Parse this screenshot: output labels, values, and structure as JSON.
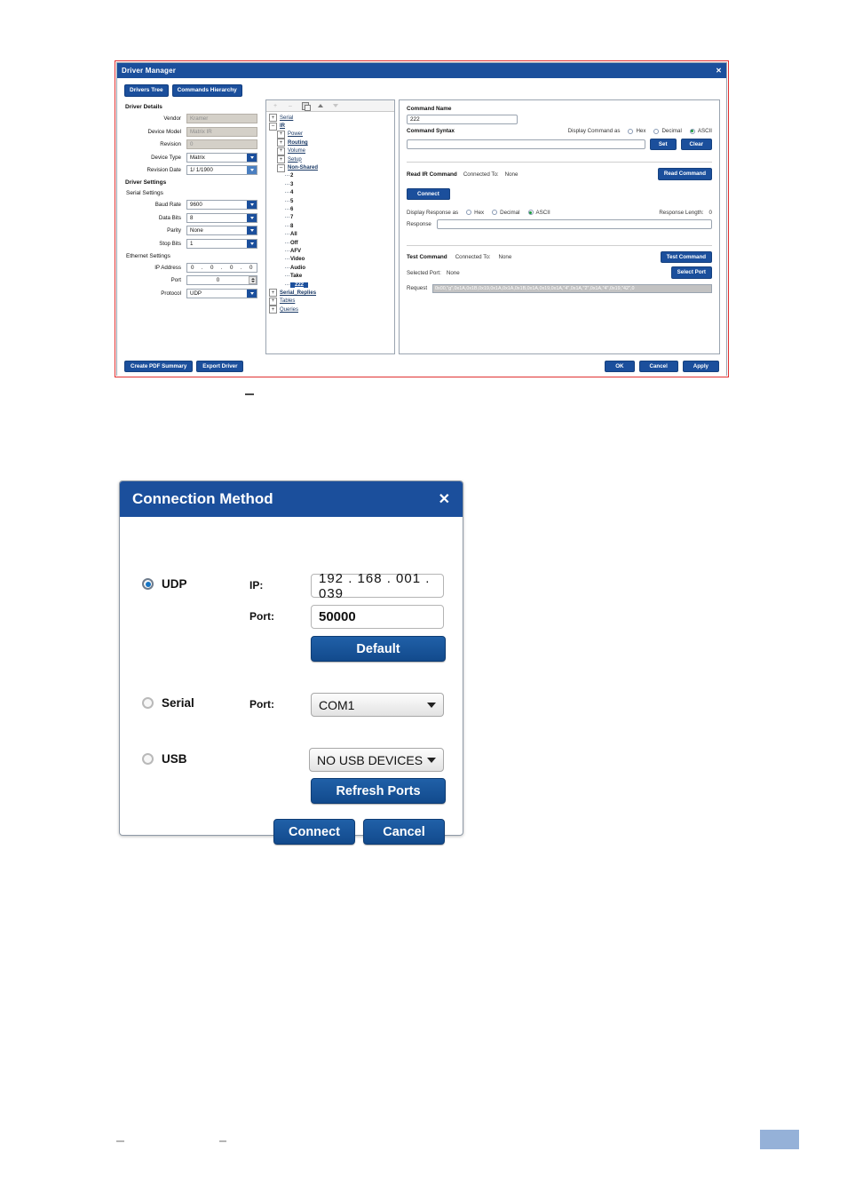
{
  "driver_manager": {
    "title": "Driver Manager",
    "close_icon": "close-icon",
    "tabs": [
      {
        "label": "Drivers Tree"
      },
      {
        "label": "Commands Hierarchy"
      }
    ],
    "driver_details": {
      "heading": "Driver Details",
      "fields": [
        {
          "label": "Vendor",
          "value": "Kramer",
          "type": "text-disabled"
        },
        {
          "label": "Device Model",
          "value": "Matrix IR",
          "type": "text-disabled"
        },
        {
          "label": "Revision",
          "value": "0",
          "type": "text-disabled"
        },
        {
          "label": "Device Type",
          "value": "Matrix",
          "type": "combo"
        },
        {
          "label": "Revision Date",
          "value": "1/ 1/1900",
          "type": "date"
        }
      ]
    },
    "driver_settings": {
      "heading": "Driver Settings",
      "serial_heading": "Serial Settings",
      "serial": [
        {
          "label": "Baud Rate",
          "value": "9600"
        },
        {
          "label": "Data Bits",
          "value": "8"
        },
        {
          "label": "Parity",
          "value": "None"
        },
        {
          "label": "Stop Bits",
          "value": "1"
        }
      ],
      "ethernet_heading": "Ethernet Settings",
      "ip_label": "IP Address",
      "ip_octets": [
        "0",
        "0",
        "0",
        "0"
      ],
      "port_label": "Port",
      "port_value": "0",
      "protocol_label": "Protocol",
      "protocol_value": "UDP"
    },
    "tree_toolbar": [
      {
        "icon": "add-icon",
        "glyph": "+"
      },
      {
        "icon": "remove-icon",
        "glyph": "–"
      },
      {
        "icon": "copy-icon",
        "glyph": ""
      },
      {
        "icon": "move-up-icon",
        "glyph": ""
      },
      {
        "icon": "move-down-icon",
        "glyph": ""
      }
    ],
    "tree": [
      {
        "label": "Serial",
        "depth": 0,
        "expander": "+",
        "bold": false,
        "leaf": false,
        "selected": false
      },
      {
        "label": "IR",
        "depth": 0,
        "expander": "–",
        "bold": true,
        "leaf": false,
        "selected": false
      },
      {
        "label": "Power",
        "depth": 1,
        "expander": "+",
        "bold": false,
        "leaf": false,
        "selected": false
      },
      {
        "label": "Routing",
        "depth": 1,
        "expander": "+",
        "bold": true,
        "leaf": false,
        "selected": false
      },
      {
        "label": "Volume",
        "depth": 1,
        "expander": "+",
        "bold": false,
        "leaf": false,
        "selected": false
      },
      {
        "label": "Setup",
        "depth": 1,
        "expander": "+",
        "bold": false,
        "leaf": false,
        "selected": false
      },
      {
        "label": "Non-Shared",
        "depth": 1,
        "expander": "–",
        "bold": true,
        "leaf": false,
        "selected": false
      },
      {
        "label": "2",
        "depth": 2,
        "expander": "",
        "bold": false,
        "leaf": true,
        "selected": false
      },
      {
        "label": "3",
        "depth": 2,
        "expander": "",
        "bold": false,
        "leaf": true,
        "selected": false
      },
      {
        "label": "4",
        "depth": 2,
        "expander": "",
        "bold": false,
        "leaf": true,
        "selected": false
      },
      {
        "label": "5",
        "depth": 2,
        "expander": "",
        "bold": false,
        "leaf": true,
        "selected": false
      },
      {
        "label": "6",
        "depth": 2,
        "expander": "",
        "bold": false,
        "leaf": true,
        "selected": false
      },
      {
        "label": "7",
        "depth": 2,
        "expander": "",
        "bold": false,
        "leaf": true,
        "selected": false
      },
      {
        "label": "8",
        "depth": 2,
        "expander": "",
        "bold": false,
        "leaf": true,
        "selected": false
      },
      {
        "label": "All",
        "depth": 2,
        "expander": "",
        "bold": false,
        "leaf": true,
        "selected": false
      },
      {
        "label": "Off",
        "depth": 2,
        "expander": "",
        "bold": false,
        "leaf": true,
        "selected": false
      },
      {
        "label": "AFV",
        "depth": 2,
        "expander": "",
        "bold": false,
        "leaf": true,
        "selected": false
      },
      {
        "label": "Video",
        "depth": 2,
        "expander": "",
        "bold": false,
        "leaf": true,
        "selected": false
      },
      {
        "label": "Audio",
        "depth": 2,
        "expander": "",
        "bold": false,
        "leaf": true,
        "selected": false
      },
      {
        "label": "Take",
        "depth": 2,
        "expander": "",
        "bold": false,
        "leaf": true,
        "selected": false
      },
      {
        "label": "222",
        "depth": 2,
        "expander": "",
        "bold": false,
        "leaf": true,
        "selected": true
      },
      {
        "label": "Serial_Replies",
        "depth": 0,
        "expander": "+",
        "bold": true,
        "leaf": false,
        "selected": false
      },
      {
        "label": "Tables",
        "depth": 0,
        "expander": "+",
        "bold": false,
        "leaf": false,
        "selected": false
      },
      {
        "label": "Queries",
        "depth": 0,
        "expander": "+",
        "bold": false,
        "leaf": false,
        "selected": false
      }
    ],
    "command": {
      "name_label": "Command Name",
      "name_value": "222",
      "syntax_label": "Command Syntax",
      "syntax_value": "",
      "display_as_label": "Display Command as",
      "display_options": [
        {
          "label": "Hex",
          "selected": false
        },
        {
          "label": "Decimal",
          "selected": false
        },
        {
          "label": "ASCII",
          "selected": true
        }
      ],
      "set_label": "Set",
      "clear_label": "Clear"
    },
    "read_ir": {
      "heading": "Read IR Command",
      "connected_to_label": "Connected To:",
      "connected_to_value": "None",
      "read_command_label": "Read Command",
      "connect_label": "Connect",
      "display_response_label": "Display Response as",
      "response_options": [
        {
          "label": "Hex",
          "selected": false
        },
        {
          "label": "Decimal",
          "selected": false
        },
        {
          "label": "ASCII",
          "selected": true
        }
      ],
      "response_length_label": "Response Length:",
      "response_length_value": "0",
      "response_label": "Response",
      "response_value": ""
    },
    "test": {
      "heading": "Test Command",
      "connected_to_label": "Connected To:",
      "connected_to_value": "None",
      "test_command_label": "Test Command",
      "selected_port_label": "Selected Port:",
      "selected_port_value": "None",
      "select_port_label": "Select Port",
      "request_label": "Request",
      "request_value": "0x00,\"g\",0x1A,0x1B,0x19,0x1A,0x1A,0x1B,0x1A,0x19,0x1A,\"4\",0x1A,\"2\",0x1A,\"4\",0x19,\"42\",0"
    },
    "footer": {
      "create_pdf_label": "Create PDF Summary",
      "export_driver_label": "Export Driver",
      "ok_label": "OK",
      "cancel_label": "Cancel",
      "apply_label": "Apply"
    }
  },
  "connection_method": {
    "title": "Connection Method",
    "close_icon": "close-icon",
    "udp": {
      "label": "UDP",
      "selected": true,
      "ip_label": "IP:",
      "ip_value": "192 . 168 . 001 . 039",
      "port_label": "Port:",
      "port_value": "50000",
      "default_label": "Default"
    },
    "serial": {
      "label": "Serial",
      "selected": false,
      "port_label": "Port:",
      "port_value": "COM1"
    },
    "usb": {
      "label": "USB",
      "selected": false,
      "device_value": "NO USB DEVICES",
      "refresh_label": "Refresh Ports"
    },
    "connect_label": "Connect",
    "cancel_label": "Cancel"
  },
  "colors": {
    "accent_blue": "#1b4f9c",
    "annotation_red": "#e03030",
    "page_marker": "#95b1d8"
  }
}
